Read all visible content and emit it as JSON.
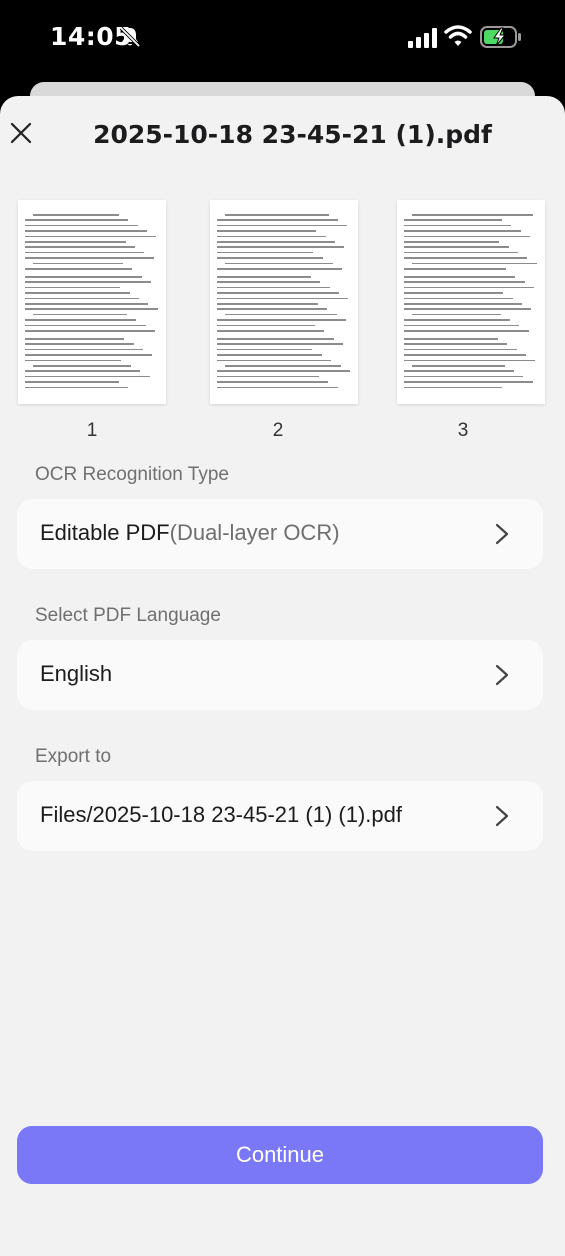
{
  "status_bar": {
    "time": "14:05",
    "icons": [
      "bell-slash-icon",
      "signal-icon",
      "wifi-icon",
      "battery-charging-icon"
    ],
    "battery_color": "#4cd964"
  },
  "header": {
    "title": "2025-10-18 23-45-21 (1).pdf",
    "close_icon": "close-icon"
  },
  "thumbnails": [
    {
      "page": "1"
    },
    {
      "page": "2"
    },
    {
      "page": "3"
    }
  ],
  "ocr": {
    "label": "OCR Recognition Type",
    "value_main": "Editable PDF",
    "value_sub": "(Dual-layer OCR)"
  },
  "language": {
    "label": "Select PDF Language",
    "value": "English"
  },
  "export": {
    "label": "Export to",
    "value": "Files/2025-10-18 23-45-21 (1) (1).pdf"
  },
  "continue_label": "Continue",
  "colors": {
    "accent": "#7a78f7",
    "sheet_bg": "#f2f2f2",
    "row_bg": "#fafafa"
  }
}
